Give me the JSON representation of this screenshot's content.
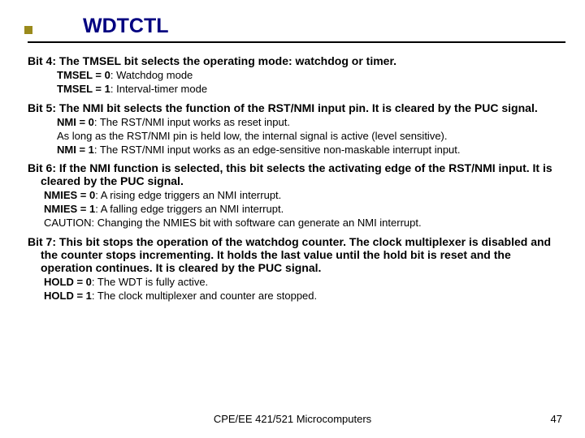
{
  "title": "WDTCTL",
  "bit4": {
    "head": "Bit 4: The TMSEL bit selects the operating mode: watchdog or timer.",
    "l1k": "TMSEL = 0",
    "l1t": ": Watchdog mode",
    "l2k": "TMSEL = 1",
    "l2t": ": Interval-timer mode"
  },
  "bit5": {
    "head": "Bit 5: The NMI bit selects the function of the RST/NMI input pin. It is cleared by the PUC signal.",
    "l1k": "NMI = 0",
    "l1t": ": The RST/NMI input works as reset input.",
    "l2": "As long as the RST/NMI pin is held low, the internal signal is active (level sensitive).",
    "l3k": "NMI = 1",
    "l3t": ": The RST/NMI input works as an edge-sensitive non-maskable interrupt input."
  },
  "bit6": {
    "head": "Bit 6: If the NMI function is selected, this bit selects the activating edge of the RST/NMI input. It is cleared by the PUC signal.",
    "l1k": "NMIES = 0",
    "l1t": ": A rising edge triggers an NMI interrupt.",
    "l2k": "NMIES = 1",
    "l2t": ": A falling edge triggers an NMI interrupt.",
    "l3": "CAUTION: Changing the NMIES bit with software can generate an NMI interrupt."
  },
  "bit7": {
    "head": "Bit 7: This bit stops the operation of the watchdog counter. The clock multiplexer is disabled and the counter stops incrementing. It holds the last value until the hold bit is reset and the operation continues. It is cleared by the PUC signal.",
    "l1k": "HOLD = 0",
    "l1t": ": The WDT is fully active.",
    "l2k": "HOLD = 1",
    "l2t": ": The clock multiplexer and counter are stopped."
  },
  "footer": {
    "course": "CPE/EE 421/521 Microcomputers",
    "page": "47"
  }
}
